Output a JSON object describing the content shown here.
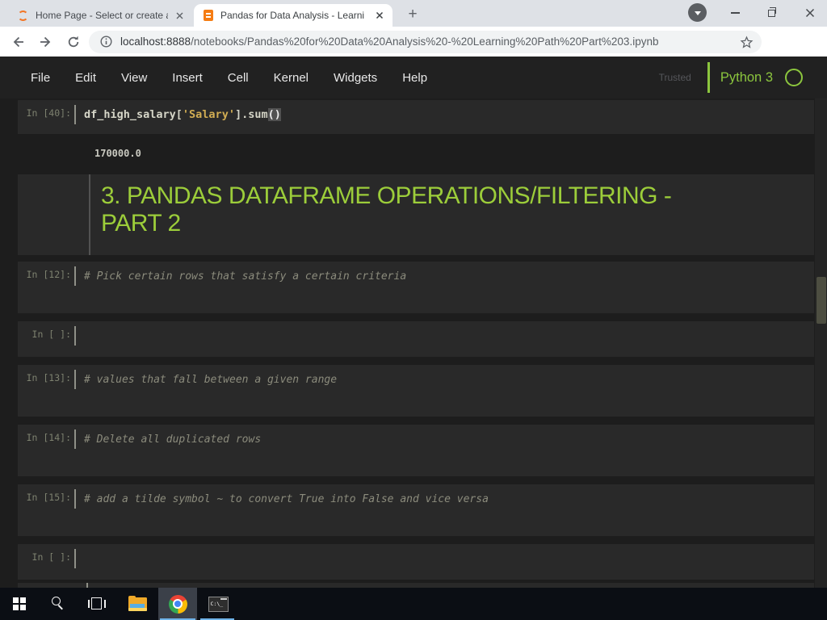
{
  "browser": {
    "tabs": [
      {
        "title": "Home Page - Select or create a n",
        "icon": "jupyter-logo-icon",
        "active": false
      },
      {
        "title": "Pandas for Data Analysis - Learni",
        "icon": "notebook-icon",
        "active": true
      }
    ],
    "new_tab_label": "+",
    "address": {
      "host": "localhost:8888",
      "path": "/notebooks/Pandas%20for%20Data%20Analysis%20-%20Learning%20Path%20Part%203.ipynb"
    }
  },
  "notebook": {
    "menu": [
      "File",
      "Edit",
      "View",
      "Insert",
      "Cell",
      "Kernel",
      "Widgets",
      "Help"
    ],
    "trusted_label": "Trusted",
    "kernel_name": "Python 3",
    "cells": [
      {
        "type": "code",
        "prompt": "In [40]:",
        "code": [
          {
            "text": "df_high_salary[",
            "style": "plain"
          },
          {
            "text": "'Salary'",
            "style": "string"
          },
          {
            "text": "].sum",
            "style": "plain"
          },
          {
            "text": "()",
            "style": "bracket"
          }
        ],
        "output": "170000.0"
      },
      {
        "type": "markdown",
        "heading": "3. PANDAS DATAFRAME OPERATIONS/FILTERING -\nPART 2"
      },
      {
        "type": "code",
        "prompt": "In [12]:",
        "comment": "# Pick certain rows that satisfy a certain criteria"
      },
      {
        "type": "code",
        "prompt": "In [ ]:"
      },
      {
        "type": "code",
        "prompt": "In [13]:",
        "comment": "# values that fall between a given range"
      },
      {
        "type": "code",
        "prompt": "In [14]:",
        "comment": "# Delete all duplicated rows"
      },
      {
        "type": "code",
        "prompt": "In [15]:",
        "comment": "# add a tilde symbol ~ to convert True into False and vice versa"
      },
      {
        "type": "code",
        "prompt": "In [ ]:"
      }
    ]
  },
  "taskbar": {
    "items": [
      "start",
      "search",
      "task-view",
      "file-explorer",
      "chrome",
      "terminal"
    ],
    "terminal_icon_text": "C:\\_"
  },
  "colors": {
    "heading_green": "#9ccd3a",
    "kernel_green": "#8cc63e",
    "string_yellow": "#d1ad53",
    "jupyter_orange": "#f37626",
    "taskbar_accent_blue": "#6fb3e8",
    "cell_bg": "#292929",
    "page_bg": "#1d1d1d",
    "tabstrip_bg": "#dee1e6"
  }
}
